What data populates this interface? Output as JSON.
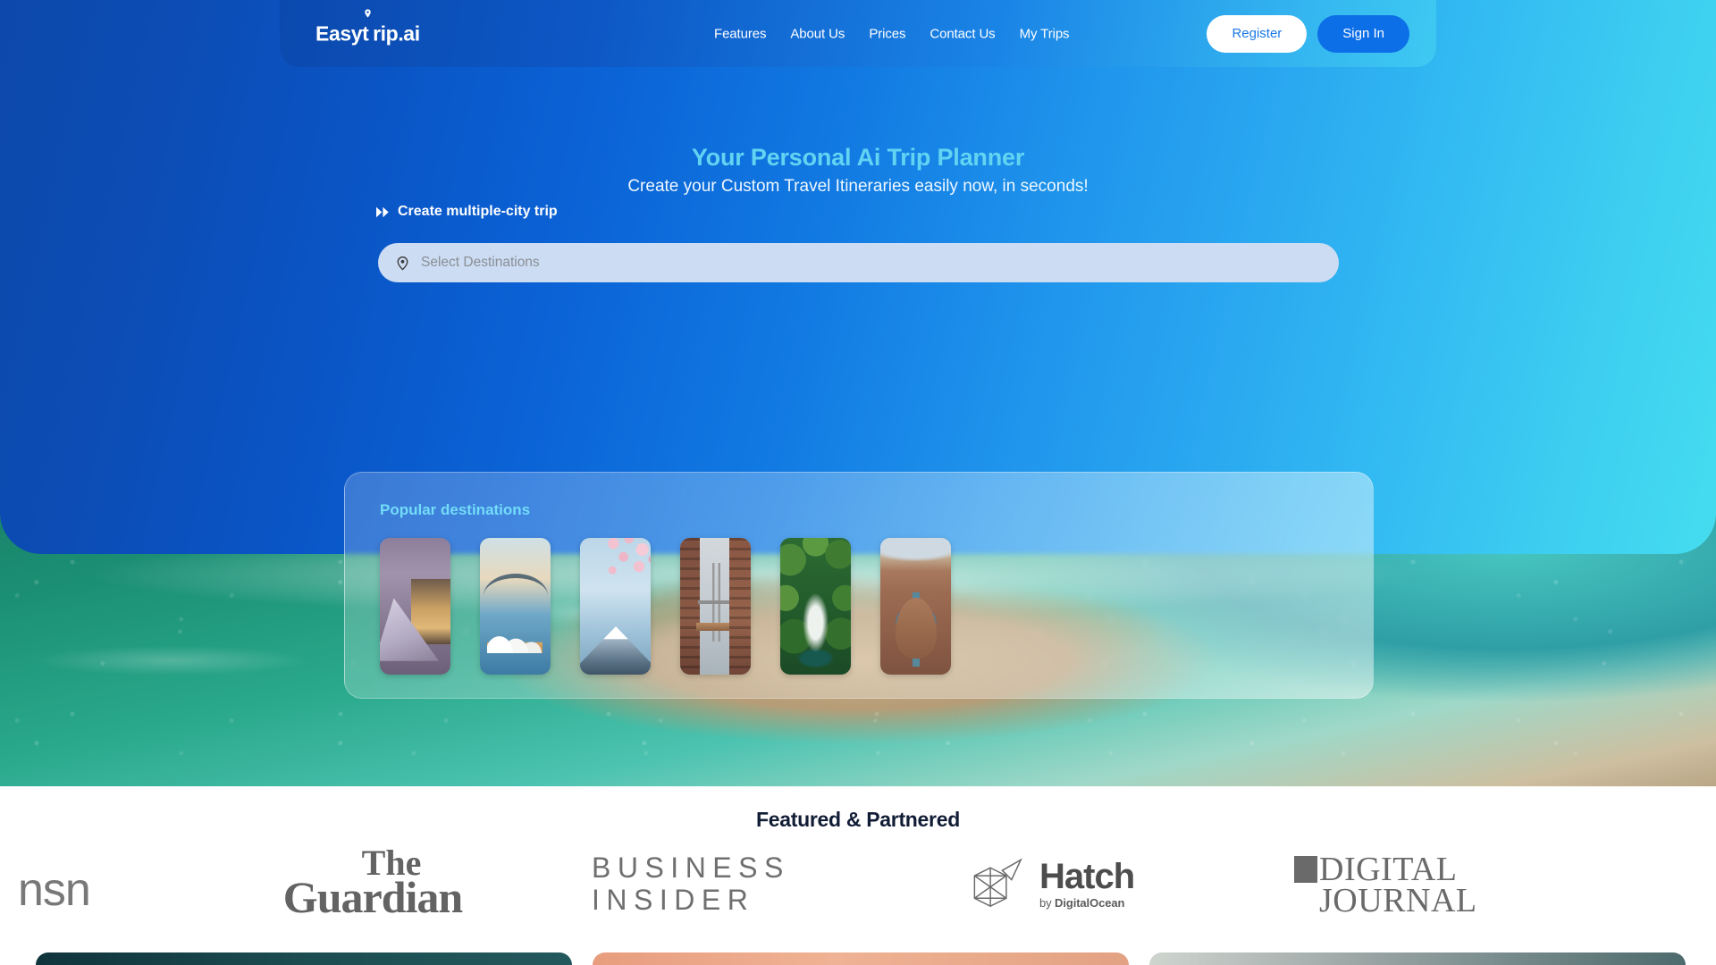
{
  "brand": {
    "name_before": "Easy",
    "name_t": "t",
    "name_after": "rip.ai",
    "full": "Easytrip.ai"
  },
  "nav": {
    "links": [
      {
        "label": "Features"
      },
      {
        "label": "About Us"
      },
      {
        "label": "Prices"
      },
      {
        "label": "Contact Us"
      },
      {
        "label": "My Trips"
      }
    ],
    "register_label": "Register",
    "signin_label": "Sign In"
  },
  "hero": {
    "title": "Your Personal Ai Trip Planner",
    "subtitle": "Create your Custom Travel Itineraries easily now, in seconds!",
    "multicity_label": "Create multiple-city trip",
    "search_value": "",
    "search_placeholder": "Select Destinations"
  },
  "popular": {
    "title": "Popular destinations",
    "items": [
      {
        "name": "paris-louvre"
      },
      {
        "name": "sydney-opera-house"
      },
      {
        "name": "mount-fuji"
      },
      {
        "name": "manhattan-bridge"
      },
      {
        "name": "jungle-waterfall"
      },
      {
        "name": "horseshoe-bend"
      }
    ]
  },
  "partners": {
    "title": "Featured & Partnered",
    "logos": [
      {
        "name": "msn",
        "text": "nsn"
      },
      {
        "name": "the-guardian",
        "line1": "The",
        "line2": "Guardian"
      },
      {
        "name": "business-insider",
        "line1": "BUSINESS",
        "line2": "INSIDER"
      },
      {
        "name": "hatch",
        "text": "Hatch",
        "by_prefix": "by ",
        "by_brand": "DigitalOcean"
      },
      {
        "name": "digital-journal",
        "line1": "DIGITAL",
        "line2": "JOURNAL"
      }
    ]
  },
  "colors": {
    "hero_blue_dark": "#0d49ab",
    "hero_blue_light": "#45dcef",
    "accent_cyan": "#62d4f2",
    "signin_blue": "#0d6fe8",
    "register_text": "#1a7ae8",
    "search_bg": "#ccdcf2",
    "partners_title": "#111c35"
  }
}
